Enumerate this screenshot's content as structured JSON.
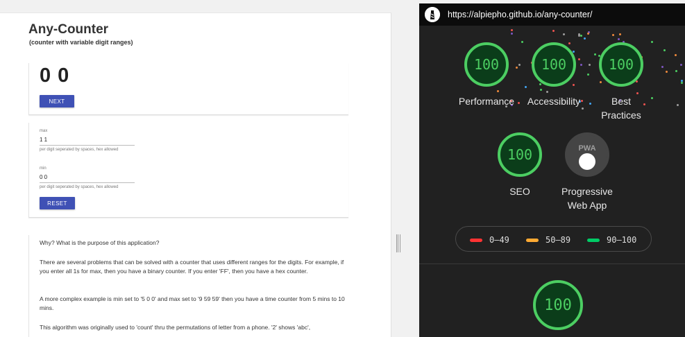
{
  "app": {
    "title": "Any-Counter",
    "subtitle": "(counter with variable digit ranges)",
    "counter_value": "0 0",
    "next_label": "NEXT",
    "reset_label": "RESET",
    "max": {
      "label": "max",
      "value": "1 1",
      "help": "per digit seperated by spaces, hex allowed"
    },
    "min": {
      "label": "min",
      "value": "0 0",
      "help": "per digit seperated by spaces, hex allowed"
    },
    "paragraphs": [
      "Why? What is the purpose of this application?",
      "There are several problems that can be solved with a counter that uses different ranges for the digits. For example, if you enter all 1s for max, then you have a binary counter. If you enter 'FF', then you have a hex counter.",
      "A more complex example is min set to '5 0 0' and max set to '9 59 59' then you have a time counter from 5 mins to 10 mins.",
      "This algorithm was originally used to 'count' thru the permutations of letter from a phone. '2' shows 'abc',"
    ]
  },
  "lighthouse": {
    "url": "https://alpiepho.github.io/any-counter/",
    "scores": [
      {
        "label": "Performance",
        "value": "100"
      },
      {
        "label": "Accessibility",
        "value": "100"
      },
      {
        "label": "Best Practices",
        "value": "100"
      },
      {
        "label": "SEO",
        "value": "100"
      },
      {
        "label": "Progressive Web App",
        "value": ""
      }
    ],
    "pwa_badge_text": "PWA",
    "legend": [
      {
        "range": "0–49",
        "color": "#f33"
      },
      {
        "range": "50–89",
        "color": "#fa3"
      },
      {
        "range": "90–100",
        "color": "#0c6"
      }
    ],
    "bottom_score": "100",
    "accent_color": "#4cce62"
  }
}
